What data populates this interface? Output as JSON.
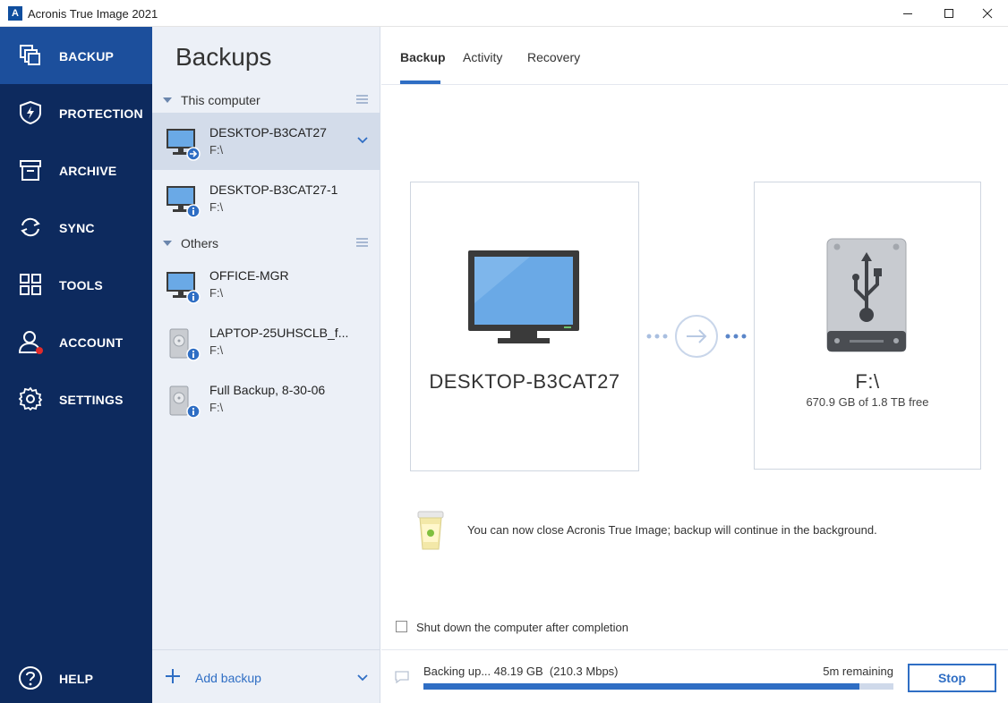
{
  "window": {
    "title": "Acronis True Image 2021",
    "logo_letter": "A",
    "icons": [
      "minimize-icon",
      "maximize-icon",
      "close-icon"
    ]
  },
  "nav": {
    "items": [
      {
        "label": "BACKUP",
        "icon": "backup-icon",
        "active": true
      },
      {
        "label": "PROTECTION",
        "icon": "shield-icon"
      },
      {
        "label": "ARCHIVE",
        "icon": "archive-box-icon"
      },
      {
        "label": "SYNC",
        "icon": "sync-icon"
      },
      {
        "label": "TOOLS",
        "icon": "tools-grid-icon"
      },
      {
        "label": "ACCOUNT",
        "icon": "account-user-icon"
      },
      {
        "label": "SETTINGS",
        "icon": "gear-icon"
      }
    ],
    "help": {
      "label": "HELP",
      "icon": "help-icon"
    }
  },
  "backups": {
    "title": "Backups",
    "groups": [
      {
        "label": "This computer",
        "items": [
          {
            "name": "DESKTOP-B3CAT27",
            "dest": "F:\\",
            "icon": "monitor-icon",
            "badge": "arrow-badge-icon",
            "selected": true
          },
          {
            "name": "DESKTOP-B3CAT27-1",
            "dest": "F:\\",
            "icon": "monitor-icon",
            "badge": "info-badge-icon"
          }
        ]
      },
      {
        "label": "Others",
        "items": [
          {
            "name": "OFFICE-MGR",
            "dest": "F:\\",
            "icon": "monitor-icon",
            "badge": "info-badge-icon"
          },
          {
            "name": "LAPTOP-25UHSCLB_f...",
            "dest": "F:\\",
            "icon": "hard-drive-icon",
            "badge": "info-badge-icon"
          },
          {
            "name": "Full Backup, 8-30-06",
            "dest": "F:\\",
            "icon": "hard-drive-icon",
            "badge": "info-badge-icon"
          }
        ]
      }
    ],
    "add_label": "Add backup"
  },
  "main": {
    "tabs": [
      {
        "label": "Backup",
        "active": true
      },
      {
        "label": "Activity"
      },
      {
        "label": "Recovery"
      }
    ],
    "source": {
      "name": "DESKTOP-B3CAT27",
      "icon": "desktop-monitor-icon"
    },
    "destination": {
      "name": "F:\\",
      "free": "670.9 GB of 1.8 TB free",
      "icon": "usb-drive-icon"
    },
    "flow_icon": "arrow-right-circle-icon",
    "notice": {
      "icon": "coffee-cup-icon",
      "text": "You can now close Acronis True Image; backup will continue in the background."
    },
    "shutdown_label": "Shut down the computer after completion",
    "status": {
      "text": "Backing up... 48.19 GB  (210.3 Mbps)",
      "remaining": "5m remaining",
      "progress_fraction": 0.927,
      "icon": "comment-icon"
    },
    "stop_label": "Stop"
  },
  "colors": {
    "nav_bg": "#0d2a5e",
    "nav_active": "#1c4f9c",
    "list_bg": "#ecf0f7",
    "list_selected": "#d3dcea",
    "accent": "#2f6ec4",
    "info_badge": "#2f6ec4"
  }
}
